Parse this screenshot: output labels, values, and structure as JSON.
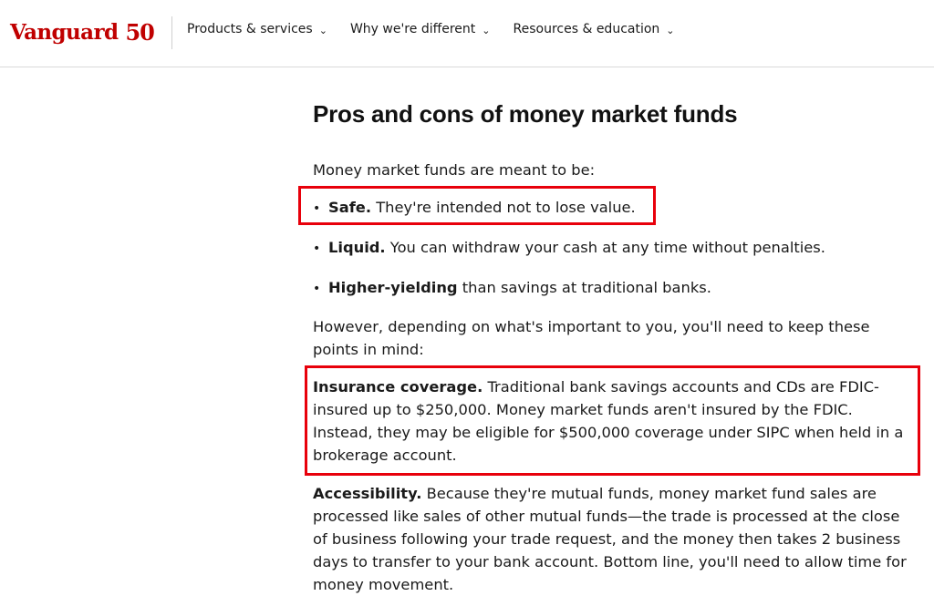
{
  "header": {
    "logo_word": "Vanguard",
    "logo_number": "50",
    "nav": [
      {
        "label": "Products & services"
      },
      {
        "label": "Why we're different"
      },
      {
        "label": "Resources & education"
      }
    ]
  },
  "article": {
    "title": "Pros and cons of money market funds",
    "intro": "Money market funds are meant to be:",
    "bullets": [
      {
        "bold": "Safe.",
        "text": " They're intended not to lose value."
      },
      {
        "bold": "Liquid.",
        "text": " You can withdraw your cash at any time without penalties."
      },
      {
        "bold": "Higher-yielding",
        "text": " than savings at traditional banks."
      }
    ],
    "however": "However, depending on what's important to you, you'll need to keep these points in mind:",
    "insurance": {
      "bold": "Insurance coverage.",
      "text": " Traditional bank savings accounts and CDs are FDIC-insured up to $250,000. Money market funds aren't insured by the FDIC. Instead, they may be eligible for $500,000 coverage under SIPC when held in a brokerage account."
    },
    "accessibility": {
      "bold": "Accessibility.",
      "text": " Because they're mutual funds, money market fund sales are processed like sales of other mutual funds—the trade is processed at the close of business following your trade request, and the money then takes 2 business days to transfer to your bank account. Bottom line, you'll need to allow time for money movement."
    }
  },
  "colors": {
    "brand": "#c00000",
    "highlight": "#e8000b"
  }
}
